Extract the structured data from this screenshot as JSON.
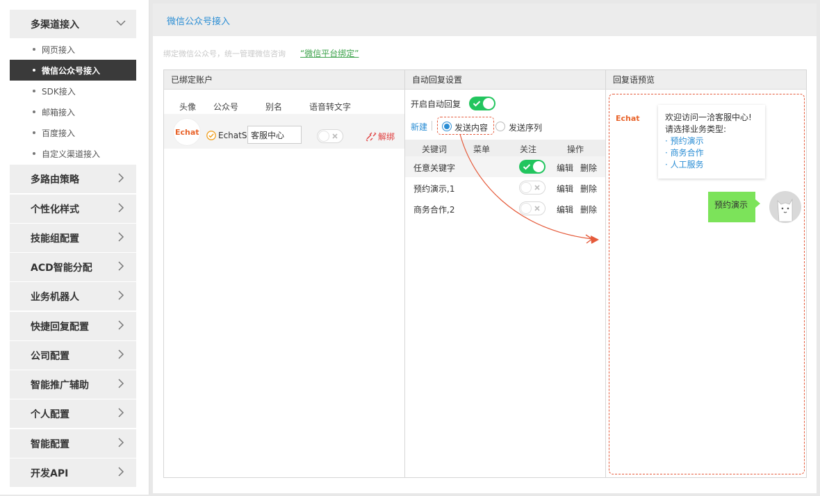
{
  "sidebar": {
    "groups": [
      {
        "label": "多渠道接入",
        "expanded": true
      },
      {
        "label": "多路由策略"
      },
      {
        "label": "个性化样式"
      },
      {
        "label": "技能组配置"
      },
      {
        "label": "ACD智能分配"
      },
      {
        "label": "业务机器人"
      },
      {
        "label": "快捷回复配置"
      },
      {
        "label": "公司配置"
      },
      {
        "label": "智能推广辅助"
      },
      {
        "label": "个人配置"
      },
      {
        "label": "智能配置"
      },
      {
        "label": "开发API"
      }
    ],
    "sub_items": [
      {
        "label": "网页接入"
      },
      {
        "label": "微信公众号接入",
        "active": true
      },
      {
        "label": "SDK接入"
      },
      {
        "label": "邮箱接入"
      },
      {
        "label": "百度接入"
      },
      {
        "label": "自定义渠道接入"
      }
    ]
  },
  "main": {
    "title": "微信公众号接入",
    "bind_tip": "绑定微信公众号，统一管理微信咨询",
    "bind_link": "“微信平台绑定”"
  },
  "accounts_panel": {
    "title": "已绑定账户",
    "columns": [
      "头像",
      "公众号",
      "别名",
      "语音转文字"
    ],
    "row": {
      "avatar_text": "Echat",
      "name": "EchatSoft",
      "alias": "客服中心",
      "voice_to_text": false,
      "unbind_label": "解绑"
    }
  },
  "auto_reply_panel": {
    "title": "自动回复设置",
    "enable_label": "开启自动回复",
    "enabled": true,
    "new_label": "新建",
    "radio_content": "发送内容",
    "radio_sequence": "发送序列",
    "selected_mode": "发送内容",
    "columns": [
      "关键词",
      "菜单",
      "关注",
      "操作"
    ],
    "edit_label": "编辑",
    "delete_label": "删除",
    "rows": [
      {
        "keyword": "任意关键字",
        "follow": true
      },
      {
        "keyword": "预约演示,1",
        "follow": false
      },
      {
        "keyword": "商务合作,2",
        "follow": false
      }
    ]
  },
  "preview_panel": {
    "title": "回复语预览",
    "logo_text": "Echat",
    "greeting_line1": "欢迎访问一洽客服中心!",
    "greeting_line2": "请选择业务类型:",
    "options": [
      "· 预约演示",
      "· 商务合作",
      "· 人工服务"
    ],
    "user_message": "预约演示"
  },
  "colors": {
    "accent_blue": "#2a8dd4",
    "toggle_green": "#22c55e",
    "highlight_red": "#e55a3a",
    "user_bubble_green": "#7ce35a",
    "active_menu": "#3a3a3a"
  }
}
